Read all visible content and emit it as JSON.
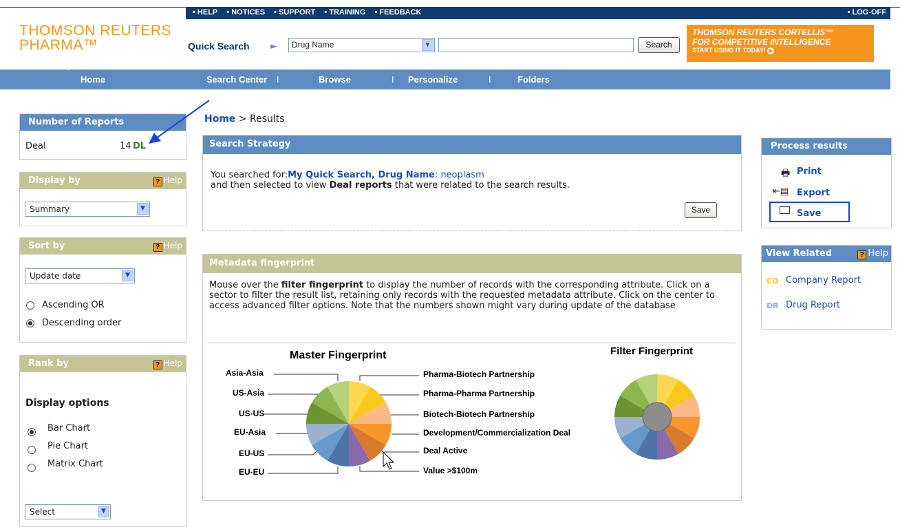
{
  "header": {
    "top_links": [
      "• HELP",
      "• NOTICES",
      "• SUPPORT",
      "• TRAINING",
      "• FEEDBACK"
    ],
    "logoff": "• LOG-OFF",
    "logo_line1": "THOMSON REUTERS",
    "logo_line2": "PHARMA™",
    "quick_search_label": "Quick Search",
    "search_field_value": "Drug Name",
    "search_input_value": "",
    "search_button": "Search",
    "promo_line1": "THOMSON REUTERS CORTELLIS™",
    "promo_line2": "FOR COMPETITIVE INTELLIGENCE",
    "promo_line3": "START USING IT TODAY!"
  },
  "nav": {
    "home": "Home",
    "search_center": "Search Center",
    "browse": "Browse",
    "personalize": "Personalize",
    "folders": "Folders",
    "separator": "I"
  },
  "left": {
    "reports": {
      "title": "Number of Reports",
      "type": "Deal",
      "count": "14",
      "code": "DL"
    },
    "display_by": {
      "title": "Display by",
      "help": "Help",
      "value": "Summary"
    },
    "sort_by": {
      "title": "Sort by",
      "help": "Help",
      "value": "Update date",
      "asc": "Ascending OR",
      "desc": "Descending order"
    },
    "rank_by": {
      "title": "Rank by",
      "help": "Help",
      "options_title": "Display options",
      "bar": "Bar Chart",
      "pie": "Pie Chart",
      "matrix": "Matrix Chart",
      "select": "Select"
    }
  },
  "breadcrumb": {
    "home": "Home",
    "current": "> Results"
  },
  "strategy": {
    "title": "Search Strategy",
    "prefix": "You searched for:",
    "link1": "My Quick Search, Drug Name",
    "link2": ": neoplasm",
    "line2_a": "and then selected to view ",
    "line2_b": "Deal reports",
    "line2_c": " that were related to the search results.",
    "save": "Save"
  },
  "fingerprint": {
    "title": "Metadata fingerprint",
    "desc_a": "Mouse over the ",
    "desc_b": "filter fingerprint",
    "desc_c": " to display the number of records with the corresponding attribute. Click on a sector to filter the result list, retaining only records with the requested metadata attribute. Click on the center to access advanced filter options. Note that the numbers shown might vary during update of the database",
    "master_title": "Master Fingerprint",
    "filter_title": "Filter Fingerprint",
    "left_labels": [
      "Asia-Asia",
      "US-Asia",
      "US-US",
      "EU-Asia",
      "EU-US",
      "EU-EU"
    ],
    "right_labels": [
      "Pharma-Biotech Partnership",
      "Pharma-Pharma Partnership",
      "Biotech-Biotech Partnership",
      "Development/Commercialization Deal",
      "Deal Active",
      "Value >$100m"
    ]
  },
  "process": {
    "title": "Process results",
    "print": "Print",
    "export": "Export",
    "save": "Save"
  },
  "related": {
    "title": "View Related",
    "help": "Help",
    "co_code": "CO",
    "company": "Company Report",
    "dr_code": "DR",
    "drug": "Drug Report"
  }
}
